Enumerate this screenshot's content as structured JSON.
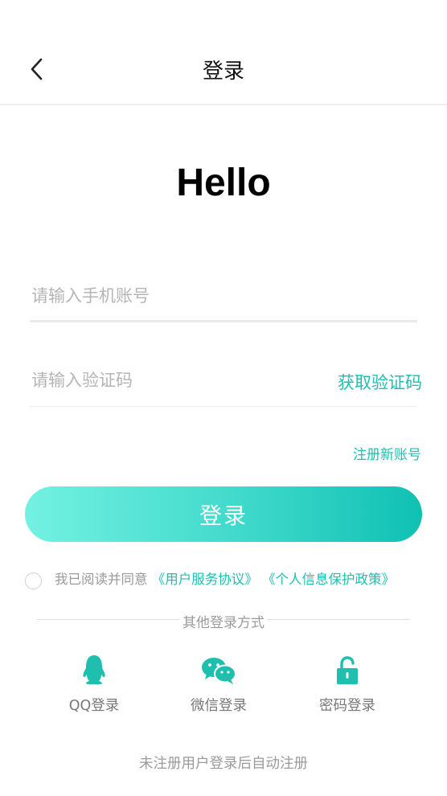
{
  "header": {
    "title": "登录",
    "back_icon": "chevron-left-icon"
  },
  "hero": {
    "greeting": "Hello"
  },
  "form": {
    "phone_placeholder": "请输入手机账号",
    "code_placeholder": "请输入验证码",
    "get_code_label": "获取验证码",
    "register_label": "注册新账号",
    "login_button_label": "登录"
  },
  "agreement": {
    "checked": false,
    "prefix": "我已阅读并同意",
    "user_agreement": "《用户服务协议》",
    "privacy_policy": "《个人信息保护政策》"
  },
  "other_login": {
    "title": "其他登录方式",
    "options": [
      {
        "label": "QQ登录",
        "icon": "qq-penguin-icon"
      },
      {
        "label": "微信登录",
        "icon": "wechat-icon"
      },
      {
        "label": "密码登录",
        "icon": "lock-icon"
      }
    ]
  },
  "footer": {
    "note": "未注册用户登录后自动注册"
  },
  "colors": {
    "accent": "#1fbfb0",
    "gradient_start": "#73f1e1",
    "gradient_end": "#0fc1b3",
    "muted": "#9a9a9a"
  }
}
